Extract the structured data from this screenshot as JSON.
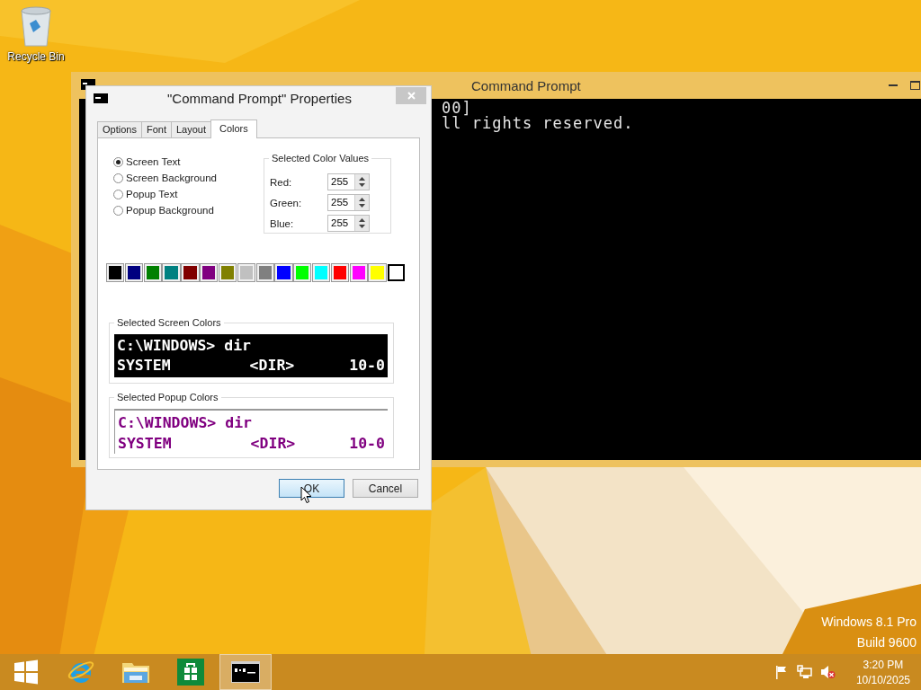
{
  "desktop": {
    "icons": [
      {
        "label": "Recycle Bin"
      }
    ],
    "watermark": [
      "Windows 8.1 Pro",
      "Build 9600"
    ]
  },
  "console_window": {
    "title": "Command Prompt",
    "lines": [
      "00]",
      "ll rights reserved."
    ]
  },
  "dialog": {
    "title": "\"Command Prompt\" Properties",
    "tabs": [
      {
        "label": "Options",
        "selected": false
      },
      {
        "label": "Font",
        "selected": false
      },
      {
        "label": "Layout",
        "selected": false
      },
      {
        "label": "Colors",
        "selected": true
      }
    ],
    "radios": [
      {
        "label": "Screen Text",
        "selected": true
      },
      {
        "label": "Screen Background",
        "selected": false
      },
      {
        "label": "Popup Text",
        "selected": false
      },
      {
        "label": "Popup Background",
        "selected": false
      }
    ],
    "color_values": {
      "title": "Selected Color Values",
      "fields": [
        {
          "label": "Red:",
          "value": "255"
        },
        {
          "label": "Green:",
          "value": "255"
        },
        {
          "label": "Blue:",
          "value": "255"
        }
      ]
    },
    "palette": [
      {
        "color": "#000000",
        "selected": false
      },
      {
        "color": "#000080",
        "selected": false
      },
      {
        "color": "#008000",
        "selected": false
      },
      {
        "color": "#008080",
        "selected": false
      },
      {
        "color": "#800000",
        "selected": false
      },
      {
        "color": "#800080",
        "selected": false
      },
      {
        "color": "#808000",
        "selected": false
      },
      {
        "color": "#c0c0c0",
        "selected": false
      },
      {
        "color": "#808080",
        "selected": false
      },
      {
        "color": "#0000ff",
        "selected": false
      },
      {
        "color": "#00ff00",
        "selected": false
      },
      {
        "color": "#00ffff",
        "selected": false
      },
      {
        "color": "#ff0000",
        "selected": false
      },
      {
        "color": "#ff00ff",
        "selected": false
      },
      {
        "color": "#ffff00",
        "selected": false
      },
      {
        "color": "#ffffff",
        "selected": true
      }
    ],
    "screen_preview": {
      "title": "Selected Screen Colors",
      "lines": [
        [
          "C:\\WINDOWS> dir"
        ],
        [
          "SYSTEM",
          "<DIR>",
          "10-0"
        ]
      ]
    },
    "popup_preview": {
      "title": "Selected Popup Colors",
      "lines": [
        [
          "C:\\WINDOWS> dir"
        ],
        [
          "SYSTEM",
          "<DIR>",
          "10-0"
        ]
      ]
    },
    "buttons": [
      {
        "label": "OK",
        "hovered": true
      },
      {
        "label": "Cancel",
        "hovered": false
      }
    ]
  },
  "taskbar": {
    "items": [
      {
        "kind": "start",
        "selected": false
      },
      {
        "kind": "browser",
        "selected": false
      },
      {
        "kind": "explorer",
        "selected": false
      },
      {
        "kind": "store",
        "selected": false
      },
      {
        "kind": "console",
        "selected": true
      }
    ],
    "clock": {
      "time": "3:20 PM",
      "date": "10/10/2025"
    }
  }
}
